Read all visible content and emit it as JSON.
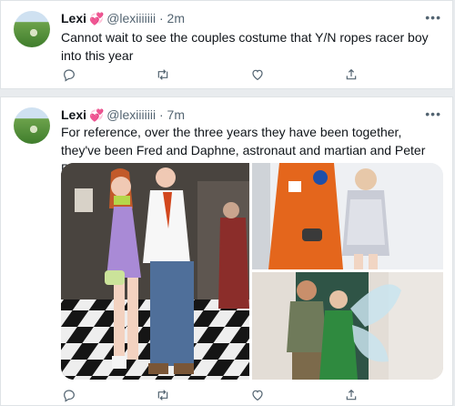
{
  "tweets": [
    {
      "name": "Lexi",
      "heart": "💞",
      "handle": "@lexiiiiiii",
      "dot": "·",
      "time": "2m",
      "text": "Cannot wait to see the couples costume that Y/N ropes racer boy into this year",
      "more": "•••"
    },
    {
      "name": "Lexi",
      "heart": "💞",
      "handle": "@lexiiiiiii",
      "dot": "·",
      "time": "7m",
      "text": "For reference, over the three years they have been together, they've been Fred and Daphne, astronaut and martian and Peter Pan and Tinkerbell",
      "more": "•••"
    }
  ],
  "actions": [
    "reply-icon",
    "retweet-icon",
    "like-icon",
    "share-icon"
  ],
  "colors": {
    "heart": "#e0308f",
    "muted": "#536471",
    "text": "#0f1419",
    "background": "#e8ebee"
  }
}
